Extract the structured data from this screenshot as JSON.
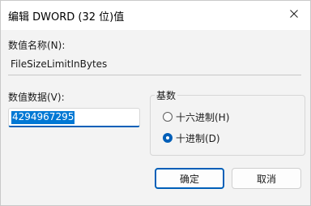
{
  "dialog": {
    "title": "编辑 DWORD (32 位)值",
    "close_icon": "close-icon"
  },
  "name_section": {
    "label": "数值名称(N):",
    "value": "FileSizeLimitInBytes"
  },
  "data_section": {
    "label": "数值数据(V):",
    "value": "4294967295"
  },
  "base_group": {
    "title": "基数",
    "options": [
      {
        "label": "十六进制(H)",
        "selected": false
      },
      {
        "label": "十进制(D)",
        "selected": true
      }
    ]
  },
  "buttons": {
    "ok": "确定",
    "cancel": "取消"
  },
  "colors": {
    "accent": "#005fb8",
    "selection": "#0078d4",
    "dialog_bg": "#f3f3f3"
  }
}
